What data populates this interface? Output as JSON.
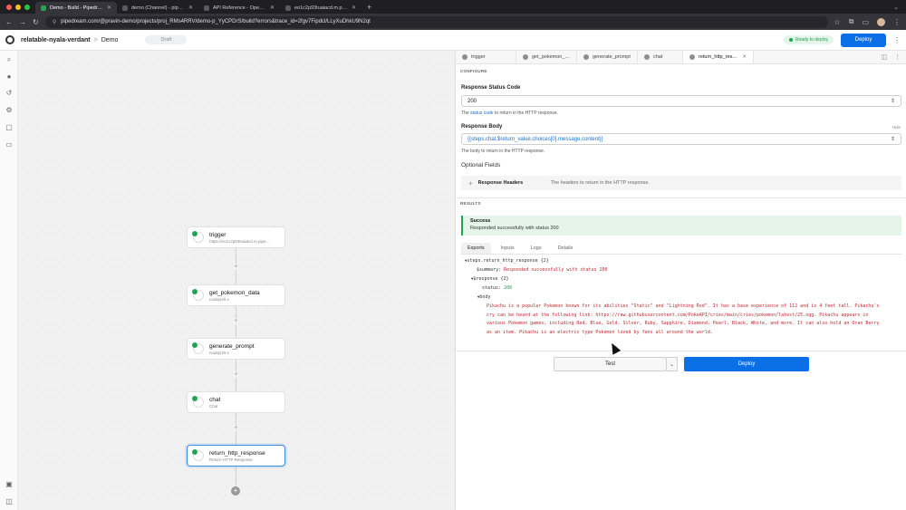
{
  "browser": {
    "tabs": [
      {
        "label": "Demo - Build - Pipedream",
        "active": true
      },
      {
        "label": "demo (Channel) - pipedrea...",
        "active": false
      },
      {
        "label": "API Reference - OpenAI API",
        "active": false
      },
      {
        "label": "eo1c2p93tuaiacd.m.pipedr...",
        "active": false
      }
    ],
    "new_tab": "+",
    "url": "pipedream.com/@pravin-demo/projects/proj_RMs4RRV/demo-p_YyCPDrS/build?errors&trace_id=2fgv7Fipdcl/LLyXuDhkU9N2qt"
  },
  "header": {
    "project": "relatable-nyala-verdant",
    "separator": ">",
    "workflow": "Demo",
    "draft_badge": "Draft",
    "ready_badge": "Ready to deploy",
    "deploy_label": "Deploy"
  },
  "canvas": {
    "nodes": [
      {
        "title": "trigger",
        "subtitle": "https://eo1c2p93tuaiacd.m.pipe..."
      },
      {
        "title": "get_pokemon_data",
        "subtitle": "nodejs20.x"
      },
      {
        "title": "generate_prompt",
        "subtitle": "nodejs20.x"
      },
      {
        "title": "chat",
        "subtitle": "Chat"
      },
      {
        "title": "return_http_response",
        "subtitle": "Return HTTP Response"
      }
    ]
  },
  "panel": {
    "tabs": [
      "trigger",
      "get_pokemon_d...",
      "generate_prompt",
      "chat",
      "return_http_res..."
    ],
    "configure_label": "CONFIGURE",
    "status_code": {
      "label": "Response Status Code",
      "value": "200",
      "help_prefix": "The ",
      "help_link": "status code",
      "help_suffix": " to return in the HTTP response."
    },
    "body": {
      "label": "Response Body",
      "hide": "Hide",
      "value": "{{steps.chat.$return_value.choices[0].message.content}}",
      "help": "The body to return in the HTTP response."
    },
    "optional_label": "Optional Fields",
    "response_headers": {
      "name": "Response Headers",
      "desc": "The headers to return in the HTTP response."
    },
    "results_label": "RESULTS",
    "success": {
      "title": "Success",
      "message": "Responded successfully with status 200"
    },
    "result_tabs": [
      "Exports",
      "Inputs",
      "Logs",
      "Details"
    ],
    "code": {
      "root": "steps.return_http_response {2}",
      "summary_key": "$summary:",
      "summary_val": "Responded successfully with status 200",
      "response_key": "$response {2}",
      "status_key": "status:",
      "status_val": "200",
      "body_key": "body",
      "body_text": "Pikachu is a popular Pokemon known for its abilities \"Static\" and \"Lightning Rod\". It has a base experience of 112 and is 4 feet tall. Pikachu's cry can be heard at the following link: https://raw.githubusercontent.com/PokeAPI/cries/main/cries/pokemon/latest/25.ogg. Pikachu appears in various Pokemon games, including Red, Blue, Gold, Silver, Ruby, Sapphire, Diamond, Pearl, Black, White, and more. It can also hold an Oran Berry as an item. Pikachu is an electric type Pokemon loved by fans all around the world."
    },
    "test_label": "Test",
    "deploy_label": "Deploy"
  },
  "colors": {
    "accent": "#0b6fe8",
    "success": "#23a455",
    "code_red": "#c0282e"
  }
}
